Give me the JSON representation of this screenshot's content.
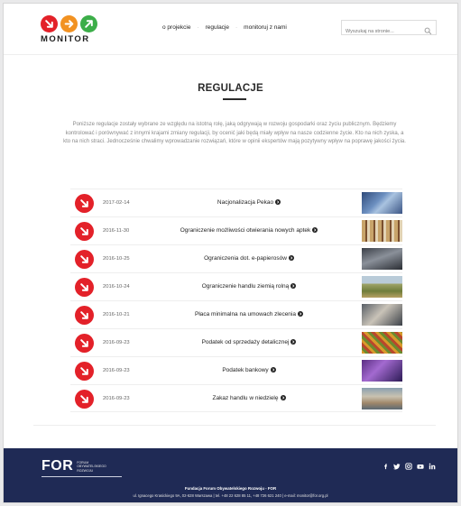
{
  "brand": {
    "name": "MONITOR",
    "dot_colors": [
      "#e32129",
      "#f29222",
      "#3cae49"
    ]
  },
  "nav": {
    "items": [
      "o projekcie",
      "regulacje",
      "monitoruj z nami"
    ]
  },
  "search": {
    "placeholder": "Wyszukaj na stronie..."
  },
  "page": {
    "title": "REGULACJE",
    "intro": "Poniższe regulacje zostały wybrane ze względu na istotną rolę, jaką odgrywają w rozwoju gospodarki oraz życiu publicznym. Będziemy kontrolować i porównywać z innymi krajami zmiany regulacji, by ocenić jaki będą miały wpływ na nasze codzienne życie. Kto na nich zyska, a kto na nich straci. Jednocześnie chwalimy wprowadzanie rozwiązań, które w opinii ekspertów mają pozytywny wpływ na poprawę jakości życia."
  },
  "regulations": [
    {
      "date": "2017-02-14",
      "name": "Nacjonalizacja Pekao",
      "thumb": "bank-building"
    },
    {
      "date": "2016-11-30",
      "name": "Ograniczenie możliwości otwierania nowych aptek",
      "thumb": "pharmacy-shelves"
    },
    {
      "date": "2016-10-25",
      "name": "Ograniczenia dot. e-papierosów",
      "thumb": "e-cigarette"
    },
    {
      "date": "2016-10-24",
      "name": "Ograniczenie handlu ziemią rolną",
      "thumb": "farmland"
    },
    {
      "date": "2016-10-21",
      "name": "Płaca minimalna na umowach zlecenia",
      "thumb": "office-workers"
    },
    {
      "date": "2016-09-23",
      "name": "Podatek od sprzedaży detalicznej",
      "thumb": "grocery-store"
    },
    {
      "date": "2016-09-23",
      "name": "Podatek bankowy",
      "thumb": "bank-interior"
    },
    {
      "date": "2016-09-23",
      "name": "Zakaz handlu w niedzielę",
      "thumb": "shopping-mall"
    }
  ],
  "footer": {
    "logo_word": "FOR",
    "logo_sub": "FORUM OBYWATELSKIEGO ROZWOJU",
    "org": "Fundacja Forum Obywatelskiego Rozwoju - FOR",
    "address": "ul. Ignacego Krasickiego 9A, 02-628 Warszawa | tel. +48 22 628 85 11, +48 726 621 240 | e-mail: monitor@for.org.pl",
    "social": [
      "facebook-icon",
      "twitter-icon",
      "instagram-icon",
      "youtube-icon",
      "linkedin-icon"
    ],
    "bg": "#1f2a55"
  }
}
